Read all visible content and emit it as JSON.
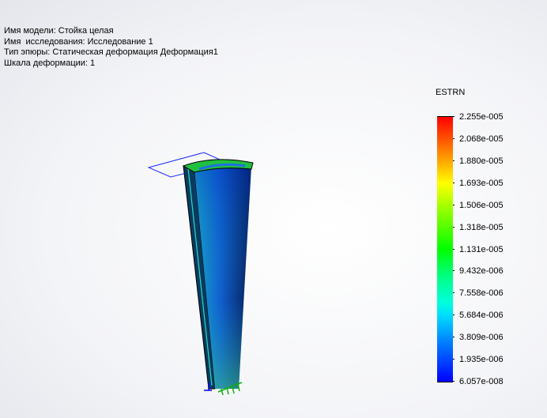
{
  "info": {
    "model": "Имя модели: Стойка целая",
    "study": "Имя  исследования: Исследование 1",
    "plot_type": "Тип эпюры: Статическая деформация Деформация1",
    "scale": "Шкала деформации: 1"
  },
  "legend": {
    "title": "ESTRN",
    "labels": [
      "2.255e-005",
      "2.068e-005",
      "1.880e-005",
      "1.693e-005",
      "1.506e-005",
      "1.318e-005",
      "1.131e-005",
      "9.432e-006",
      "7.558e-006",
      "5.684e-006",
      "3.809e-006",
      "1.935e-006",
      "6.057e-008"
    ]
  }
}
